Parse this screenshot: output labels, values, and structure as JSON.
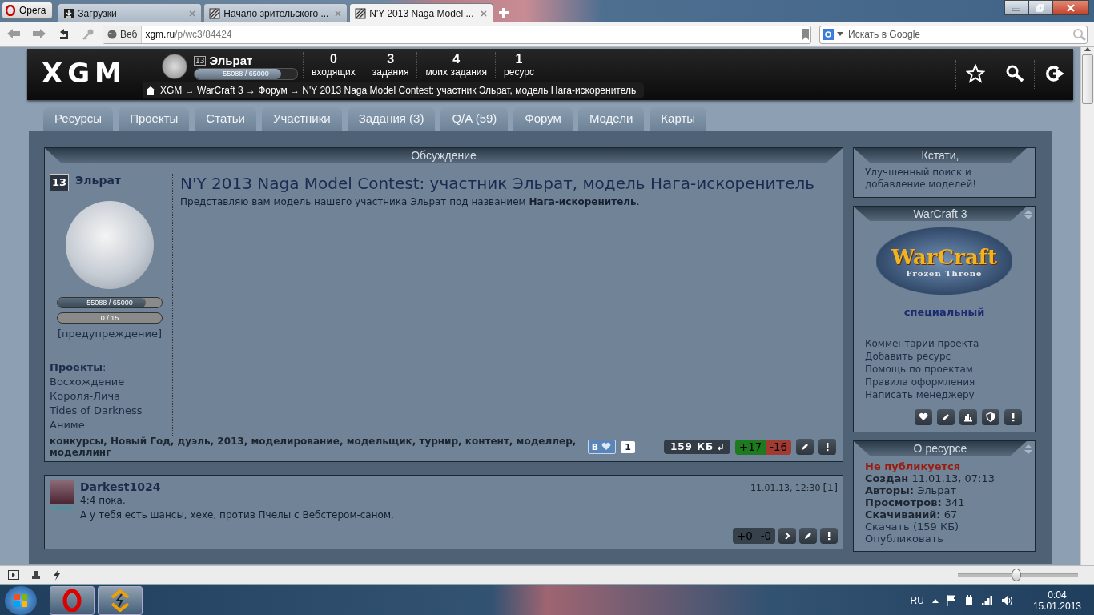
{
  "browser": {
    "menu_button": "Opera",
    "tabs": [
      {
        "label": "Загрузки",
        "kind": "download",
        "selected": false
      },
      {
        "label": "Начало зрительского ...",
        "kind": "page",
        "selected": false
      },
      {
        "label": "N'Y 2013 Naga Model ...",
        "kind": "page",
        "selected": true
      }
    ],
    "address": {
      "prefix": "Веб",
      "host": "xgm.ru",
      "path": "/p/wc3/84424"
    },
    "search": {
      "placeholder": "Искать в Google"
    }
  },
  "site_header": {
    "logo": "XGM",
    "user": {
      "rank": "13",
      "name": "Эльрат",
      "xp": "55088 / 65000",
      "level": 0.847
    },
    "stats": [
      {
        "value": "0",
        "label": "входящих"
      },
      {
        "value": "3",
        "label": "задания"
      },
      {
        "value": "4",
        "label": "моих задания"
      },
      {
        "value": "1",
        "label": "ресурс"
      }
    ],
    "breadcrumb": "XGM → WarCraft 3 → Форум → N'Y 2013 Naga Model Contest: участник Эльрат, модель Нага-искоренитель"
  },
  "nav_tabs": [
    "Ресурсы",
    "Проекты",
    "Статьи",
    "Участники",
    "Задания (3)",
    "Q/A (59)",
    "Форум",
    "Модели",
    "Карты"
  ],
  "discussion": {
    "title": "Обсуждение",
    "post": {
      "rank": "13",
      "author": "Эльрат",
      "xp": {
        "text": "55088 / 65000",
        "level": 0.847
      },
      "warnings": {
        "text": "0 / 15",
        "level": 0
      },
      "warning_link": "[предупреждение]",
      "projects_label": "**Проекты**:",
      "projects": [
        "Восхождение Короля-Лича",
        "Tides of Darkness",
        "Аниме"
      ],
      "title": "N'Y 2013 Naga Model Contest: участник Эльрат, модель Нага-искоренитель",
      "body": "Представляю вам модель нашего участника Эльрат под названием **Нага-искоренитель**.",
      "tags": "конкурсы, Новый Год, дуэль, 2013, моделирование, модельщик, турнир, контент, моделлер, моделлинг",
      "like_label": "В",
      "like_count": "1",
      "size": "159 КБ",
      "plus": "+17",
      "minus": "-16"
    },
    "comment": {
      "author": "Darkest1024",
      "date": "11.01.13, 12:30",
      "index": "[1]",
      "lines": [
        "4:4 пока.",
        "А у тебя есть шансы, хехе, против Пчелы с Вебстером-саном."
      ],
      "plus": "+0",
      "minus": "-0"
    }
  },
  "sidebar": {
    "tip": {
      "title": "Кстати,",
      "text": "Улучшенный поиск и добавление моделей!"
    },
    "project": {
      "title": "WarCraft 3",
      "logo_title": "WarCraft",
      "logo_subtitle": "Frozen Throne",
      "tag": "специальный",
      "links": [
        "Комментарии проекта",
        "Добавить ресурс",
        "Помощь по проектам",
        "Правила оформления",
        "Написать менеджеру"
      ]
    },
    "resource": {
      "title": "О ресурсе",
      "status": "Не публикуется",
      "facts": [
        "**Создан** 11.01.13, 07:13",
        "**Авторы:** Эльрат",
        "**Просмотров:** 341",
        "**Скачиваний:** 67"
      ],
      "links": [
        "Скачать (159 КБ)",
        "Опубликовать"
      ]
    }
  },
  "status_bar": {
    "zoom": {
      "level": 0.48
    }
  },
  "taskbar": {
    "language": "RU",
    "time": "0:04",
    "date": "15.01.2013"
  }
}
